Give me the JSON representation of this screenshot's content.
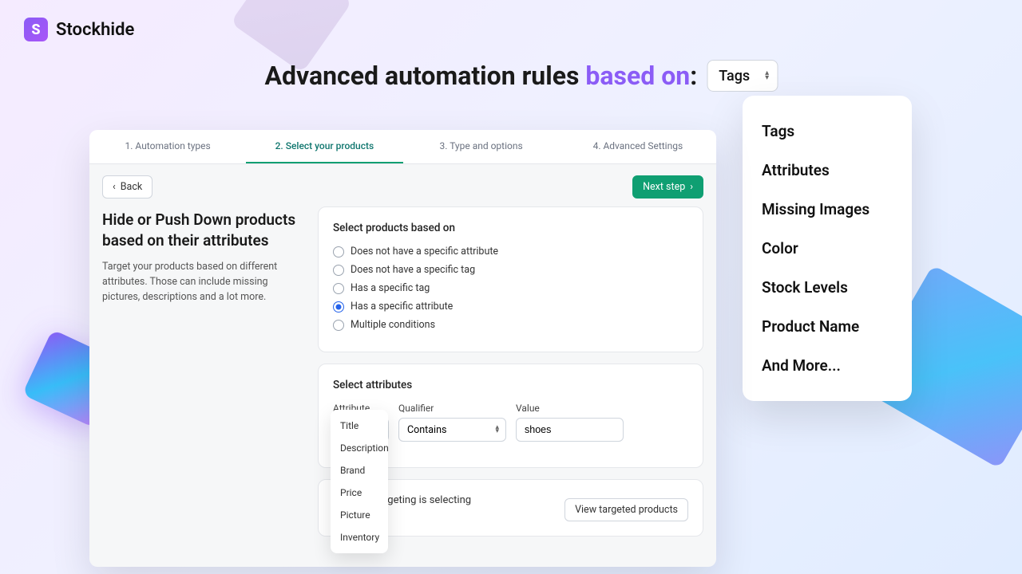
{
  "brand": "Stockhide",
  "headline": {
    "pre": "Advanced automation rules ",
    "accent": "based on",
    "post": ":",
    "selected": "Tags"
  },
  "big_dropdown": [
    "Tags",
    "Attributes",
    "Missing Images",
    "Color",
    "Stock Levels",
    "Product Name",
    "And More..."
  ],
  "tabs": [
    "1. Automation types",
    "2. Select your products",
    "3. Type and options",
    "4. Advanced Settings"
  ],
  "buttons": {
    "back": "Back",
    "next": "Next step"
  },
  "left": {
    "title": "Hide or Push Down products based on their attributes",
    "desc": "Target your products based on different attributes. Those can include missing pictures, descriptions and a lot more."
  },
  "card1": {
    "title": "Select products based on",
    "options": [
      "Does not have a specific attribute",
      "Does not have a specific tag",
      "Has a specific tag",
      "Has a specific attribute",
      "Multiple conditions"
    ],
    "selected": 3
  },
  "card2": {
    "title": "Select attributes",
    "labels": {
      "attr": "Attribute",
      "qual": "Qualifier",
      "val": "Value"
    },
    "values": {
      "attr": "Title",
      "qual": "Contains",
      "val": "shoes"
    },
    "menu": [
      "Title",
      "Description",
      "Brand",
      "Price",
      "Picture",
      "Inventory"
    ]
  },
  "card3": {
    "partial": "rgeting is selecting",
    "view": "View targeted products"
  }
}
